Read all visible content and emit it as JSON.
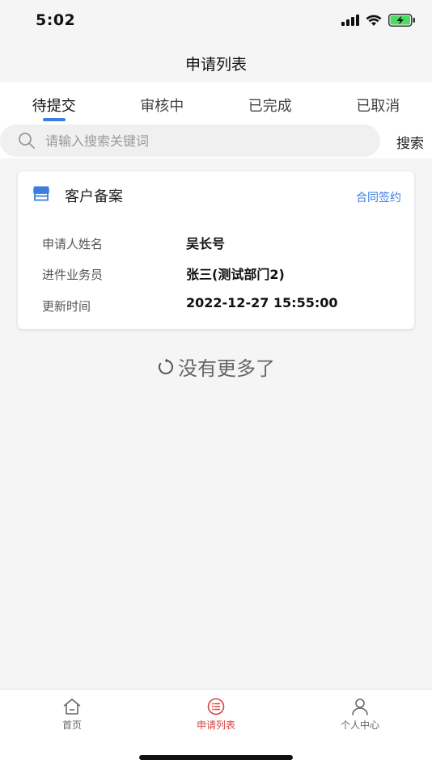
{
  "status": {
    "time": "5:02"
  },
  "nav": {
    "title": "申请列表"
  },
  "tabs": [
    {
      "label": "待提交",
      "active": true
    },
    {
      "label": "审核中",
      "active": false
    },
    {
      "label": "已完成",
      "active": false
    },
    {
      "label": "已取消",
      "active": false
    }
  ],
  "search": {
    "placeholder": "请输入搜索关键词",
    "value": "",
    "button_label": "搜索"
  },
  "card": {
    "icon": "store-icon",
    "title": "客户备案",
    "action": "合同签约",
    "rows": [
      {
        "label": "申请人姓名",
        "value": "吴长号"
      },
      {
        "label": "进件业务员",
        "value": "张三(测试部门2)"
      },
      {
        "label": "更新时间",
        "value": "2022-12-27 15:55:00"
      }
    ]
  },
  "list_footer": "没有更多了",
  "bottom_nav": [
    {
      "label": "首页",
      "icon": "home-icon",
      "active": false
    },
    {
      "label": "申请列表",
      "icon": "list-icon",
      "active": true
    },
    {
      "label": "个人中心",
      "icon": "user-icon",
      "active": false
    }
  ],
  "colors": {
    "accent": "#3b7ee0",
    "active_nav": "#d9413f",
    "background": "#f5f5f5"
  }
}
